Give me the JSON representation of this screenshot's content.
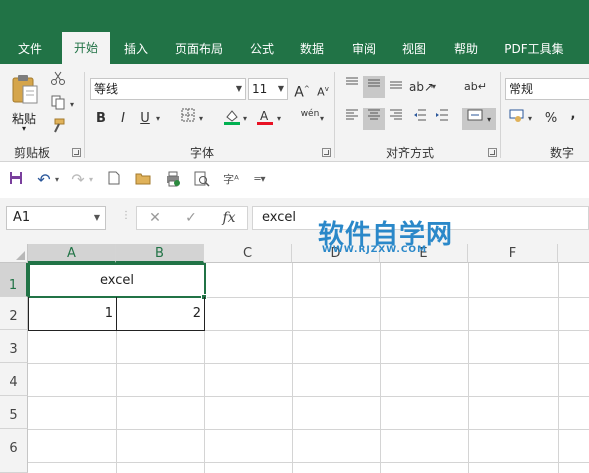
{
  "tabs": [
    {
      "label": "文件",
      "active": false
    },
    {
      "label": "开始",
      "active": true
    },
    {
      "label": "插入",
      "active": false
    },
    {
      "label": "页面布局",
      "active": false
    },
    {
      "label": "公式",
      "active": false
    },
    {
      "label": "数据",
      "active": false
    },
    {
      "label": "审阅",
      "active": false
    },
    {
      "label": "视图",
      "active": false
    },
    {
      "label": "帮助",
      "active": false
    },
    {
      "label": "PDF工具集",
      "active": false
    }
  ],
  "ribbon": {
    "clipboard": {
      "label": "剪贴板",
      "paste_label": "粘贴"
    },
    "font": {
      "label": "字体",
      "font_name": "等线",
      "font_size": "11",
      "bold": "B",
      "italic": "I",
      "underline": "U",
      "phonetic": "wén"
    },
    "alignment": {
      "label": "对齐方式"
    },
    "number": {
      "label": "数字",
      "format": "常规",
      "percent": "%",
      "comma": ","
    }
  },
  "formula_bar": {
    "name_box": "A1",
    "fx": "fx",
    "content": "excel"
  },
  "columns": [
    "A",
    "B",
    "C",
    "D",
    "E",
    "F"
  ],
  "rows": [
    "1",
    "2",
    "3",
    "4",
    "5",
    "6"
  ],
  "cells": {
    "a1_merged": "excel",
    "a2": "1",
    "b2": "2"
  },
  "watermark": {
    "title": "软件自学网",
    "url": "WWW.RJZXW.COM"
  },
  "colors": {
    "accent": "#217346",
    "watermark": "#2a88c9"
  }
}
